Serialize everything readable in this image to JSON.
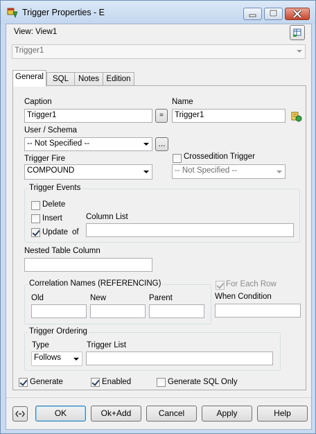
{
  "window": {
    "title": "Trigger Properties - E"
  },
  "view": {
    "label": "View: View1",
    "selector_value": "Trigger1"
  },
  "tabs": [
    {
      "label": "General"
    },
    {
      "label": "SQL"
    },
    {
      "label": "Notes"
    },
    {
      "label": "Edition"
    }
  ],
  "general": {
    "caption_label": "Caption",
    "caption_value": "Trigger1",
    "equals_label": "=",
    "name_label": "Name",
    "name_value": "Trigger1",
    "user_schema_label": "User / Schema",
    "user_schema_value": "-- Not Specified --",
    "browse_label": "...",
    "trigger_fire_label": "Trigger Fire",
    "trigger_fire_value": "COMPOUND",
    "crossedition_label": "Crossedition Trigger",
    "crossedition_value": "-- Not Specified --",
    "trigger_events": {
      "caption": "Trigger Events",
      "delete_label": "Delete",
      "insert_label": "Insert",
      "update_label": "Update",
      "of_label": "of",
      "column_list_label": "Column List",
      "delete_checked": false,
      "insert_checked": false,
      "update_checked": true
    },
    "nested_table_label": "Nested Table Column",
    "correlation": {
      "caption": "Correlation Names (REFERENCING)",
      "old_label": "Old",
      "new_label": "New",
      "parent_label": "Parent"
    },
    "for_each_row_label": "For Each Row",
    "for_each_row_checked": true,
    "when_condition_label": "When Condition",
    "ordering": {
      "caption": "Trigger Ordering",
      "type_label": "Type",
      "type_value": "Follows",
      "trigger_list_label": "Trigger List"
    }
  },
  "options": {
    "generate_label": "Generate",
    "generate_checked": true,
    "enabled_label": "Enabled",
    "enabled_checked": true,
    "generate_sql_only_label": "Generate SQL Only",
    "generate_sql_only_checked": false
  },
  "buttons": {
    "ok": "OK",
    "ok_add": "Ok+Add",
    "cancel": "Cancel",
    "apply": "Apply",
    "help": "Help"
  }
}
